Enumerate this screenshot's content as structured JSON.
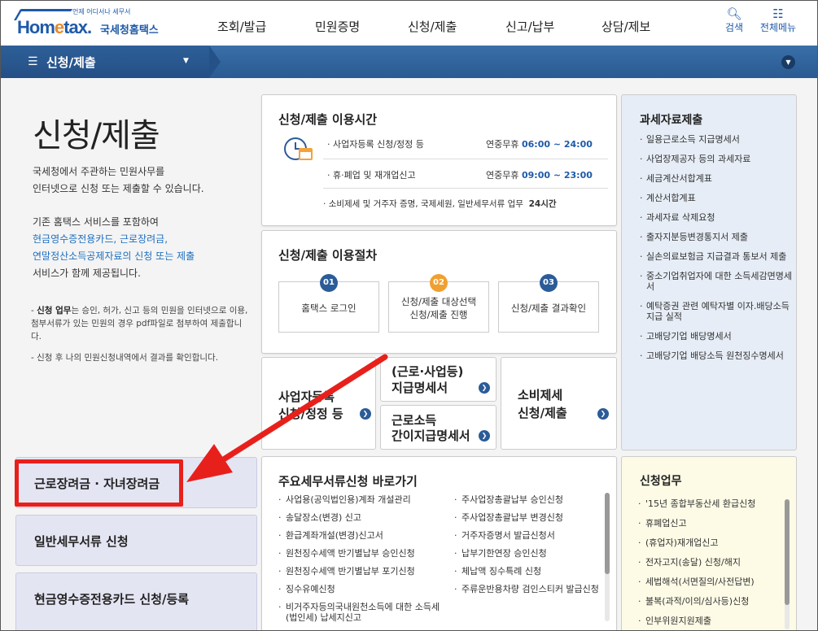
{
  "header": {
    "logo_sub": "언제 어디서나 세무서",
    "logo_mark_a": "Hom",
    "logo_mark_b": "e",
    "logo_mark_c": "tax.",
    "logo_name": "국세청홈택스",
    "nav": [
      "조회/발급",
      "민원증명",
      "신청/제출",
      "신고/납부",
      "상담/제보"
    ],
    "search_label": "검색",
    "menu_label": "전체메뉴"
  },
  "breadcrumb": {
    "label": "신청/제출"
  },
  "intro": {
    "title": "신청/제출",
    "p1": [
      "국세청에서 주관하는 민원사무를",
      "인터넷으로 신청 또는 제출할 수 있습니다."
    ],
    "p2_a": "기존 홈택스 서비스를 포함하여",
    "p2_blue": [
      "현금영수증전용카드, 근로장려금,",
      "연말정산소득공제자료의 신청 또는 제출"
    ],
    "p2_c": "서비스가 함께 제공됩니다.",
    "note1_bold": "신청 업무",
    "note1": "는 승인, 허가, 신고 등의 민원을 인터넷으로 이용, 첨부서류가 있는 민원의 경우 pdf파일로 첨부하여 제출합니다.",
    "note2": "신청 후 나의 민원신청내역에서 결과를 확인합니다."
  },
  "hours": {
    "title": "신청/제출 이용시간",
    "rows": [
      {
        "desc": "사업자등록 신청/정정 등",
        "days": "연중무휴",
        "time": "06:00 ~ 24:00"
      },
      {
        "desc": "휴·폐업 및 재개업신고",
        "days": "연중무휴",
        "time": "09:00 ~ 23:00"
      }
    ],
    "row3_desc": "소비제세 및 거주자 증명, 국제세원, 일반세무서류 업무",
    "row3_time": "24시간"
  },
  "procedure": {
    "title": "신청/제출 이용절차",
    "steps": [
      {
        "num": "01",
        "l1": "홈택스 로그인",
        "l2": ""
      },
      {
        "num": "02",
        "l1": "신청/제출 대상선택",
        "l2": "신청/제출 진행"
      },
      {
        "num": "03",
        "l1": "신청/제출 결과확인",
        "l2": ""
      }
    ]
  },
  "quick": {
    "biz_l1": "사업자등록",
    "biz_l2": "신청/정정 등",
    "wage_l1": "(근로·사업등)",
    "wage_l2": "지급명세서",
    "simple_l1": "근로소득",
    "simple_l2": "간이지급명세서",
    "excise_l1": "소비제세",
    "excise_l2": "신청/제출"
  },
  "tax_data": {
    "title": "과세자료제출",
    "items": [
      "일용근로소득 지급명세서",
      "사업장제공자 등의 과세자료",
      "세금계산서합계표",
      "계산서합계표",
      "과세자료 삭제요청",
      "출자지분등변경통지서 제출",
      "실손의료보험금 지급결과 통보서 제출",
      "중소기업취업자에 대한 소득세감면명세서",
      "예탁증권 관련 예탁자별 이자.배당소득 지급 실적",
      "고배당기업 배당명세서",
      "고배당기업 배당소득 원천징수명세서"
    ]
  },
  "left_buttons": [
    "근로장려금 · 자녀장려금",
    "일반세무서류 신청",
    "현금영수증전용카드 신청/등록"
  ],
  "shortcuts": {
    "title": "주요세무서류신청 바로가기",
    "col1": [
      "사업용(공익법인용)계좌 개설관리",
      "송달장소(변경) 신고",
      "환급계좌개설(변경)신고서",
      "원천징수세액 반기별납부 승인신청",
      "원천징수세액 반기별납부 포기신청",
      "징수유예신청",
      "비거주자등의국내원천소득에 대한 소득세(법인세) 납세지신고"
    ],
    "col2": [
      "주사업장총괄납부 승인신청",
      "주사업장총괄납부 변경신청",
      "거주자증명서 발급신청서",
      "납부기한연장 승인신청",
      "체납액 징수특례 신청",
      "주류운반용차량 검인스티커 발급신청"
    ]
  },
  "apply_work": {
    "title": "신청업무",
    "items": [
      "'15년 종합부동산세 환급신청",
      "휴폐업신고",
      "(휴업자)재개업신고",
      "전자고지(송달) 신청/해지",
      "세법해석(서면질의/사전답변)",
      "불복(과적/이의/심사등)신청",
      "인부위원지원제출"
    ]
  },
  "colors": {
    "brand": "#1e5aa8",
    "bar": "#2f639c",
    "highlight": "#e8201c",
    "sidebox": "#e6edf6",
    "apply_box": "#fdfbe6"
  },
  "icons": [
    "search-icon",
    "grid-menu-icon",
    "hamburger-icon",
    "chevron-down-icon",
    "clock-calendar-icon",
    "go-arrow-icon"
  ]
}
